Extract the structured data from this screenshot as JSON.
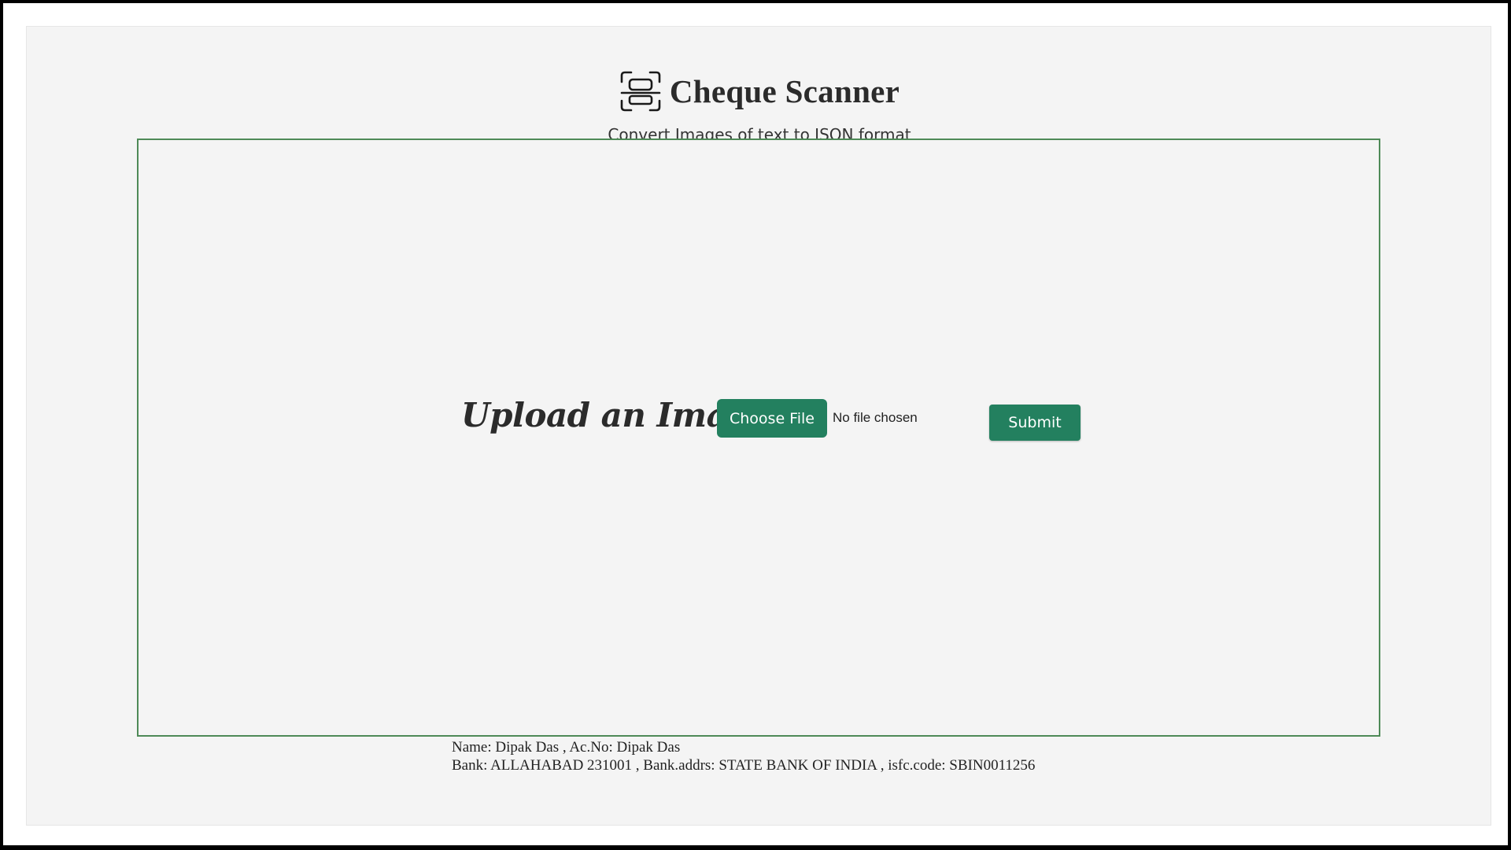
{
  "header": {
    "title": "Cheque Scanner",
    "subtitle": "Convert Images of text to JSON format",
    "icon": "scan-icon"
  },
  "upload": {
    "label": "Upload an Image",
    "choose_file_label": "Choose File",
    "file_status": "No file chosen",
    "submit_label": "Submit"
  },
  "result": {
    "line1": "Name: Dipak Das , Ac.No: Dipak Das",
    "line2": "Bank: ALLAHABAD 231001 , Bank.addrs: STATE BANK OF INDIA , isfc.code: SBIN0011256"
  },
  "colors": {
    "accent": "#23805f",
    "border": "#4e8a57",
    "panel_bg": "#f4f4f4"
  }
}
